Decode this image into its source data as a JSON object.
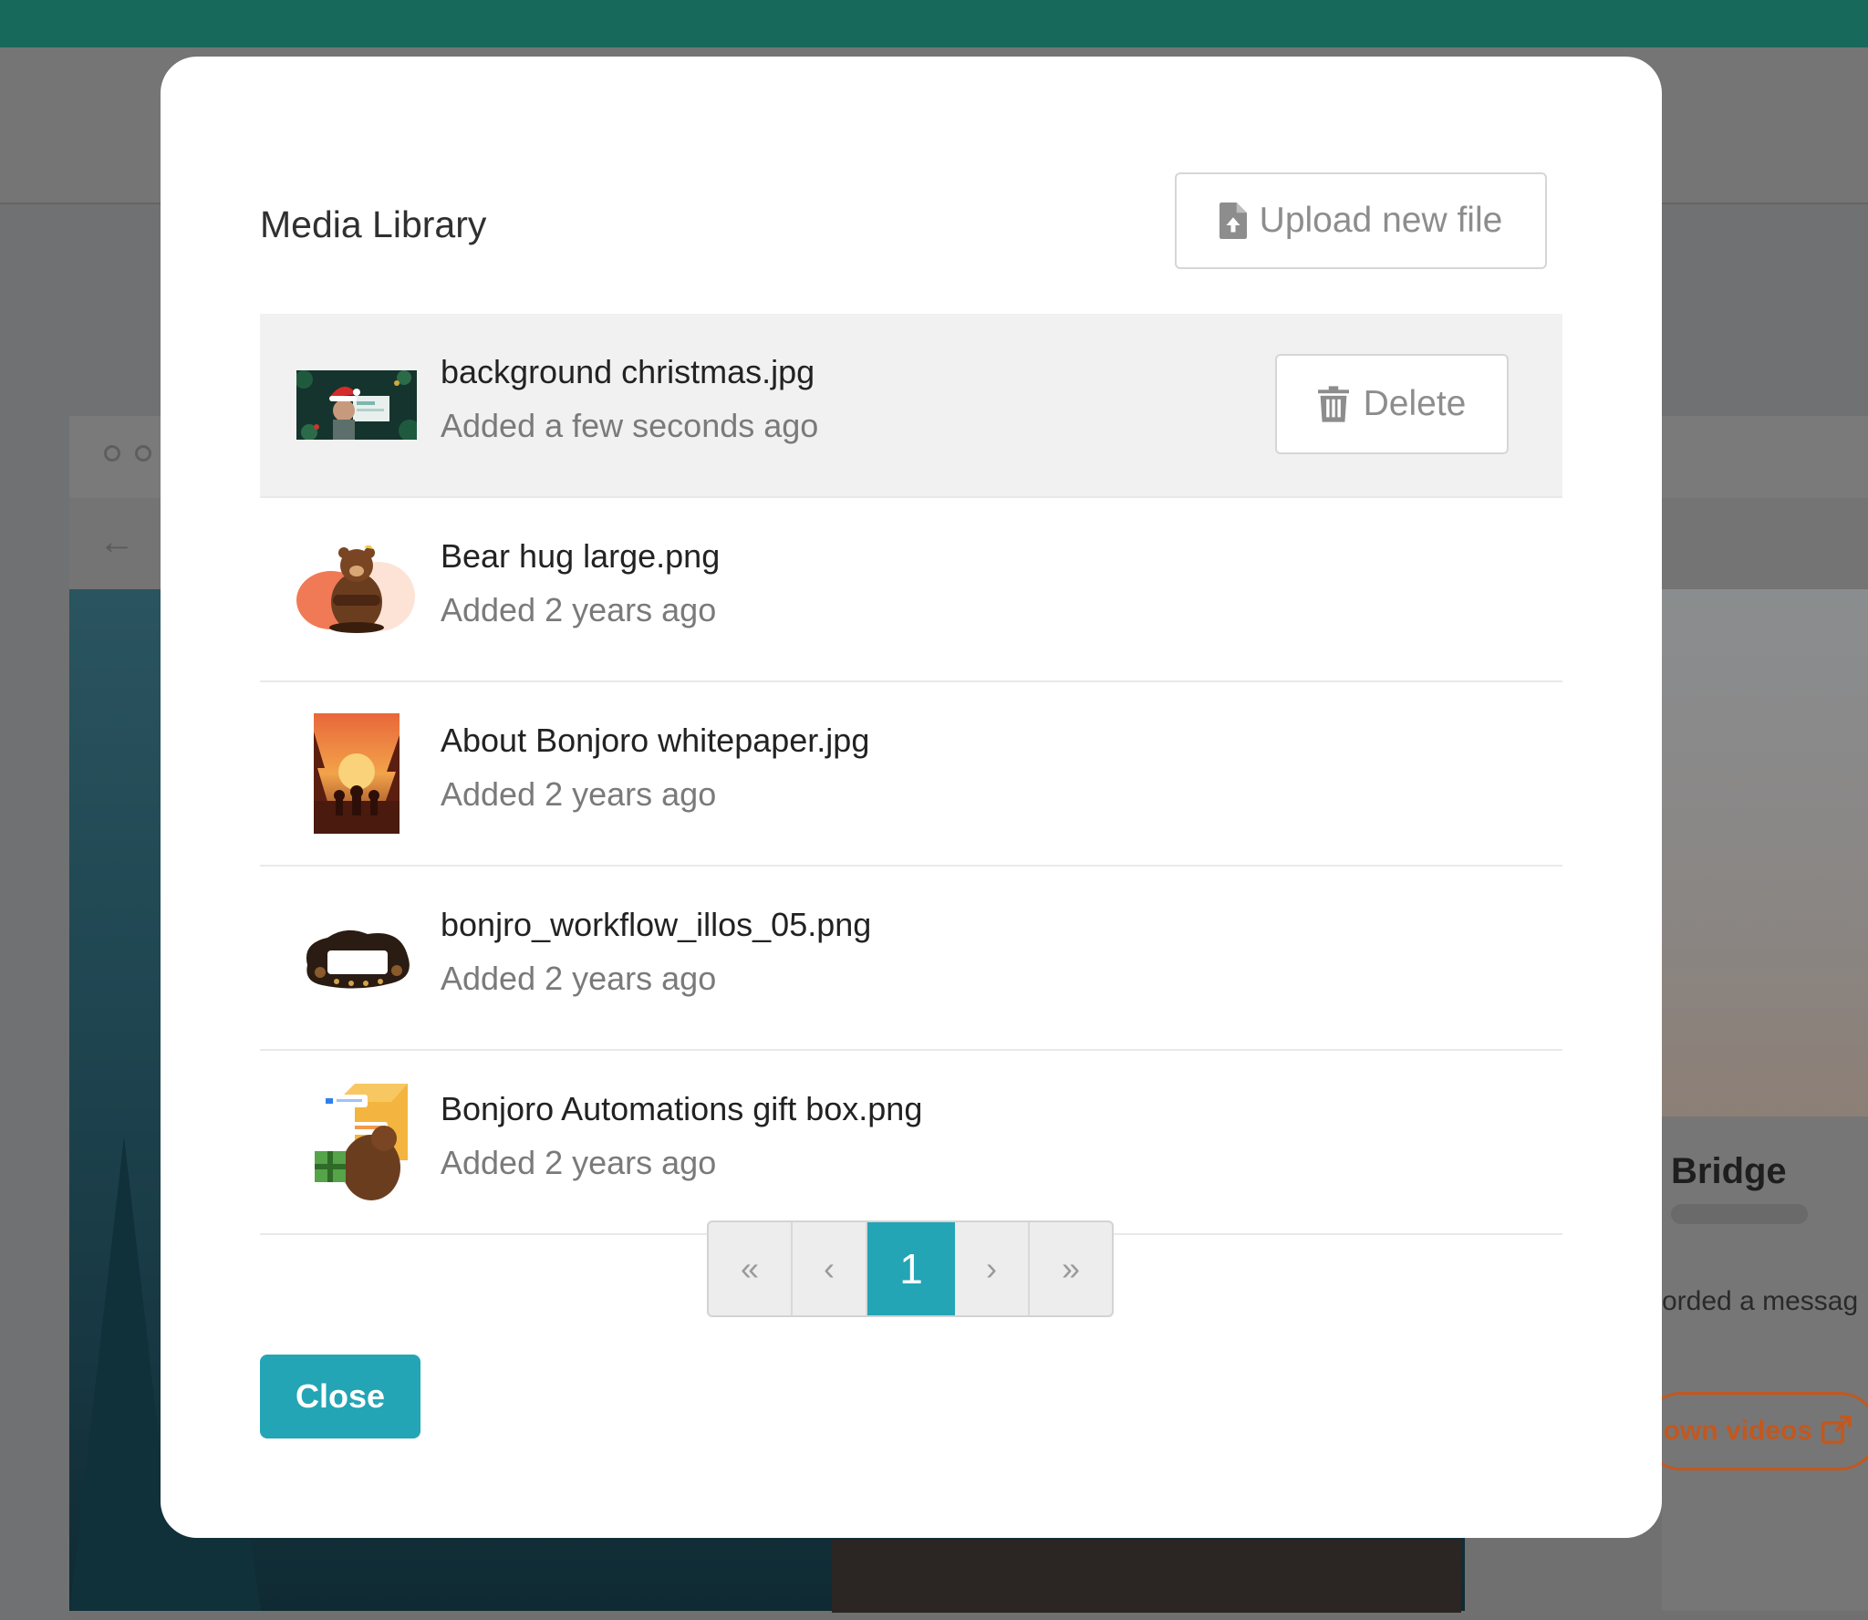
{
  "colors": {
    "accent": "#23a5b5",
    "topbar": "#17695c",
    "selected_row": "#f1f1f1",
    "muted_text": "#7a7a7a"
  },
  "modal": {
    "title": "Media Library",
    "upload_button_label": "Upload new file",
    "upload_icon": "file-upload-icon",
    "delete_button_label": "Delete",
    "delete_icon": "trash-icon",
    "close_button_label": "Close"
  },
  "files": [
    {
      "name": "background christmas.jpg",
      "added": "Added a few seconds ago",
      "selected": true
    },
    {
      "name": "Bear hug large.png",
      "added": "Added 2 years ago",
      "selected": false
    },
    {
      "name": "About Bonjoro whitepaper.jpg",
      "added": "Added 2 years ago",
      "selected": false
    },
    {
      "name": "bonjro_workflow_illos_05.png",
      "added": "Added 2 years ago",
      "selected": false
    },
    {
      "name": "Bonjoro Automations gift box.png",
      "added": "Added 2 years ago",
      "selected": false
    }
  ],
  "pagination": {
    "first": "«",
    "prev": "‹",
    "current": "1",
    "next": "›",
    "last": "»"
  },
  "background": {
    "card_title": "Bridge",
    "card_text": "orded a messag",
    "card_button": "own videos"
  }
}
